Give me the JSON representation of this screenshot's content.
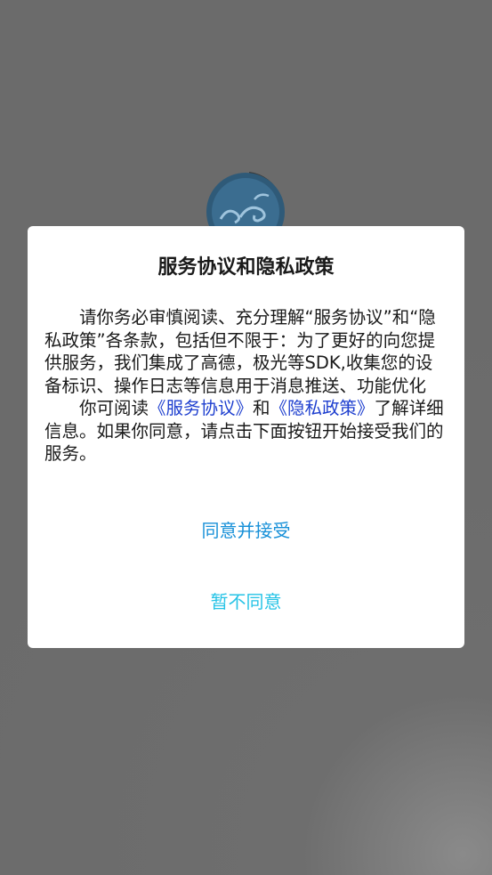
{
  "dialog": {
    "title": "服务协议和隐私政策",
    "para1": "请你务必审慎阅读、充分理解“服务协议”和“隐私政策”各条款，包括但不限于：为了更好的向您提供服务，我们集成了高德，极光等SDK,收集您的设备标识、操作日志等信息用于消息推送、功能优化",
    "para2_prefix": "你可阅读",
    "service_link": "《服务协议》",
    "para2_and": "和",
    "privacy_link": "《隐私政策》",
    "para2_suffix": "了解详细信息。如果你同意，请点击下面按钮开始接受我们的服务。",
    "agree_label": "同意并接受",
    "decline_label": "暂不同意"
  },
  "icons": {
    "logo": "app-logo-icon"
  },
  "colors": {
    "overlay": "#6d6d6d",
    "link": "#1e3fcf",
    "agree": "#1790d8",
    "decline": "#26c3e6"
  }
}
